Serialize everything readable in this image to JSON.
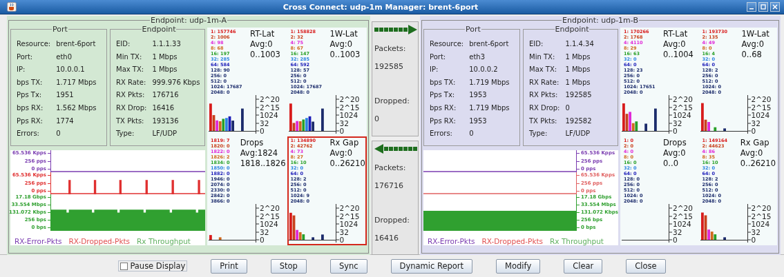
{
  "window": {
    "title": "Cross Connect: udp-1m  Manager: brent-6port"
  },
  "endpoints": [
    {
      "title": "Endpoint: udp-1m-A",
      "color": "#d3e8d3",
      "port": {
        "title": "Port",
        "rows": [
          {
            "label": "Resource:",
            "value": "brent-6port"
          },
          {
            "label": "Port:",
            "value": "eth0"
          },
          {
            "label": "IP:",
            "value": "10.0.0.1"
          },
          {
            "label": "bps TX:",
            "value": "1.717 Mbps"
          },
          {
            "label": "Pps Tx:",
            "value": "1951"
          },
          {
            "label": "bps RX:",
            "value": "1.562 Mbps"
          },
          {
            "label": "Pps RX:",
            "value": "1774"
          },
          {
            "label": "Errors:",
            "value": "0"
          }
        ]
      },
      "endpoint": {
        "title": "Endpoint",
        "rows": [
          {
            "label": "EID:",
            "value": "1.1.1.33"
          },
          {
            "label": "Min TX:",
            "value": "1 Mbps"
          },
          {
            "label": "Max TX:",
            "value": "1 Mbps"
          },
          {
            "label": "RX Rate:",
            "value": "999.976 Kbps"
          },
          {
            "label": "RX Pkts:",
            "value": "176716"
          },
          {
            "label": "RX Drop:",
            "value": "16416"
          },
          {
            "label": "TX Pkts:",
            "value": "193136"
          },
          {
            "label": "Type:",
            "value": "LF/UDP"
          }
        ]
      },
      "graph": {
        "kind": "leftaxis",
        "strips": [
          {
            "kind": "line",
            "color": "#7a3cb0",
            "labels": [
              "65.536 Kpps",
              "256 pps",
              "0 pps"
            ]
          },
          {
            "kind": "spikes",
            "color": "#e03030",
            "labels": [
              "65.536 Kpps",
              "256 pps",
              "0 pps"
            ]
          },
          {
            "kind": "area-dips",
            "color": "#30a030",
            "labels": [
              "17.18 Gbps",
              "33.554 Mbps",
              "131.072 Kbps",
              "256 bps",
              "0 bps"
            ]
          }
        ],
        "legend": [
          {
            "text": "RX-Error-Pkts",
            "color": "#7a3cb0"
          },
          {
            "text": "RX-Dropped-Pkts",
            "color": "#e05050"
          },
          {
            "text": "Rx Throughput",
            "color": "#60b060"
          }
        ]
      },
      "histograms": [
        {
          "title": "RT-Lat",
          "avg": "Avg:0",
          "range": "0..1003",
          "selected": false,
          "buckets": [
            {
              "text": "1: 157746",
              "color": "#d81c1c"
            },
            {
              "text": "2: 1006",
              "color": "#c8401c"
            },
            {
              "text": "4: 98",
              "color": "#e028d8"
            },
            {
              "text": "8: 68",
              "color": "#d0681c"
            },
            {
              "text": "16: 197",
              "color": "#28a028"
            },
            {
              "text": "32: 285",
              "color": "#2c84e0"
            },
            {
              "text": "64: 584",
              "color": "#1c1cb8"
            },
            {
              "text": "128: 90",
              "color": "#1c2c6c"
            },
            {
              "text": "256: 0",
              "color": "#1c2c6c"
            },
            {
              "text": "512: 0",
              "color": "#1c2c6c"
            },
            {
              "text": "1024: 17687",
              "color": "#1c2c6c"
            },
            {
              "text": "2048: 0",
              "color": "#1c2c6c"
            }
          ],
          "axis_labels": [
            "2^20",
            "2^15",
            "1024",
            "32",
            "0"
          ]
        },
        {
          "title": "1W-Lat",
          "avg": "Avg:0",
          "range": "0..1003",
          "selected": false,
          "buckets": [
            {
              "text": "1: 158828",
              "color": "#d81c1c"
            },
            {
              "text": "2: 32",
              "color": "#c8401c"
            },
            {
              "text": "4: 75",
              "color": "#e028d8"
            },
            {
              "text": "8: 67",
              "color": "#d0681c"
            },
            {
              "text": "16: 147",
              "color": "#28a028"
            },
            {
              "text": "32: 285",
              "color": "#2c84e0"
            },
            {
              "text": "64: 592",
              "color": "#1c1cb8"
            },
            {
              "text": "128: 57",
              "color": "#1c2c6c"
            },
            {
              "text": "256: 0",
              "color": "#1c2c6c"
            },
            {
              "text": "512: 0",
              "color": "#1c2c6c"
            },
            {
              "text": "1024: 17687",
              "color": "#1c2c6c"
            },
            {
              "text": "2048: 0",
              "color": "#1c2c6c"
            }
          ],
          "axis_labels": [
            "2^20",
            "2^15",
            "1024",
            "32",
            "0"
          ]
        },
        {
          "title": "Drops",
          "avg": "Avg:1824",
          "range": "1818..1826",
          "selected": false,
          "buckets": [
            {
              "text": "1819: 7",
              "color": "#d81c1c"
            },
            {
              "text": "1820: 0",
              "color": "#c8401c"
            },
            {
              "text": "1822: 0",
              "color": "#e028d8"
            },
            {
              "text": "1826: 2",
              "color": "#d0681c"
            },
            {
              "text": "1834: 0",
              "color": "#28a028"
            },
            {
              "text": "1850: 0",
              "color": "#2c84e0"
            },
            {
              "text": "1882: 0",
              "color": "#1c1cb8"
            },
            {
              "text": "1946: 0",
              "color": "#1c2c6c"
            },
            {
              "text": "2074: 0",
              "color": "#1c2c6c"
            },
            {
              "text": "2330: 0",
              "color": "#1c2c6c"
            },
            {
              "text": "2842: 0",
              "color": "#1c2c6c"
            },
            {
              "text": "3866: 0",
              "color": "#1c2c6c"
            }
          ],
          "axis_labels": [
            "2^20",
            "2^15",
            "1024",
            "32",
            "0"
          ]
        },
        {
          "title": "Rx Gap",
          "avg": "Avg:0",
          "range": "0..26210",
          "selected": true,
          "buckets": [
            {
              "text": "1: 134890",
              "color": "#d81c1c"
            },
            {
              "text": "2: 42762",
              "color": "#c8401c"
            },
            {
              "text": "4: 73",
              "color": "#e028d8"
            },
            {
              "text": "8: 27",
              "color": "#d0681c"
            },
            {
              "text": "16: 10",
              "color": "#28a028"
            },
            {
              "text": "32: 0",
              "color": "#2c84e0"
            },
            {
              "text": "64: 0",
              "color": "#1c1cb8"
            },
            {
              "text": "128: 2",
              "color": "#1c2c6c"
            },
            {
              "text": "256: 0",
              "color": "#1c2c6c"
            },
            {
              "text": "512: 0",
              "color": "#1c2c6c"
            },
            {
              "text": "1024: 9",
              "color": "#1c2c6c"
            },
            {
              "text": "2048: 0",
              "color": "#1c2c6c"
            }
          ],
          "axis_labels": [
            "2^20",
            "2^15",
            "1024",
            "32",
            "0"
          ]
        }
      ]
    },
    {
      "title": "Endpoint: udp-1m-B",
      "color": "#dcdcf0",
      "port": {
        "title": "Port",
        "rows": [
          {
            "label": "Resource:",
            "value": "brent-6port"
          },
          {
            "label": "Port:",
            "value": "eth3"
          },
          {
            "label": "IP:",
            "value": "10.0.0.2"
          },
          {
            "label": "bps TX:",
            "value": "1.719 Mbps"
          },
          {
            "label": "Pps Tx:",
            "value": "1953"
          },
          {
            "label": "bps RX:",
            "value": "1.719 Mbps"
          },
          {
            "label": "Pps RX:",
            "value": "1953"
          },
          {
            "label": "Errors:",
            "value": "0"
          }
        ]
      },
      "endpoint": {
        "title": "Endpoint",
        "rows": [
          {
            "label": "EID:",
            "value": "1.1.4.34"
          },
          {
            "label": "Min TX:",
            "value": "1 Mbps"
          },
          {
            "label": "Max TX:",
            "value": "1 Mbps"
          },
          {
            "label": "RX Rate:",
            "value": "1 Mbps"
          },
          {
            "label": "RX Pkts:",
            "value": "192585"
          },
          {
            "label": "RX Drop:",
            "value": "0"
          },
          {
            "label": "TX Pkts:",
            "value": "192582"
          },
          {
            "label": "Type:",
            "value": "LF/UDP"
          }
        ]
      },
      "graph": {
        "kind": "rightaxis",
        "strips": [
          {
            "kind": "line",
            "color": "#7a3cb0",
            "labels": [
              "65.536 Kpps",
              "256 pps",
              "0 pps"
            ]
          },
          {
            "kind": "line",
            "color": "#e06060",
            "labels": [
              "65.536 Kpps",
              "256 pps",
              "0 pps"
            ]
          },
          {
            "kind": "area",
            "color": "#30a030",
            "labels": [
              "17.18 Gbps",
              "33.554 Mbps",
              "131.072 Kbps",
              "256 bps",
              "0 bps"
            ]
          }
        ],
        "legend": [
          {
            "text": "RX-Error-Pkts",
            "color": "#7a3cb0"
          },
          {
            "text": "RX-Dropped-Pkts",
            "color": "#e05050"
          },
          {
            "text": "Rx Throughput",
            "color": "#60b060"
          }
        ]
      },
      "histograms": [
        {
          "title": "RT-Lat",
          "avg": "Avg:0",
          "range": "0..1004",
          "selected": false,
          "buckets": [
            {
              "text": "1: 170266",
              "color": "#d81c1c"
            },
            {
              "text": "2: 1768",
              "color": "#c8401c"
            },
            {
              "text": "4: 4110",
              "color": "#e028d8"
            },
            {
              "text": "8: 29",
              "color": "#d0681c"
            },
            {
              "text": "16: 63",
              "color": "#28a028"
            },
            {
              "text": "32: 0",
              "color": "#2c84e0"
            },
            {
              "text": "64: 0",
              "color": "#1c1cb8"
            },
            {
              "text": "128: 23",
              "color": "#1c2c6c"
            },
            {
              "text": "256: 0",
              "color": "#1c2c6c"
            },
            {
              "text": "512: 0",
              "color": "#1c2c6c"
            },
            {
              "text": "1024: 17651",
              "color": "#1c2c6c"
            },
            {
              "text": "2048: 0",
              "color": "#1c2c6c"
            }
          ],
          "axis_labels": [
            "2^20",
            "2^15",
            "1024",
            "32",
            "0"
          ]
        },
        {
          "title": "1W-Lat",
          "avg": "Avg:0",
          "range": "0..68",
          "selected": false,
          "buckets": [
            {
              "text": "1: 193730",
              "color": "#d81c1c"
            },
            {
              "text": "2: 135",
              "color": "#c8401c"
            },
            {
              "text": "4: 49",
              "color": "#e028d8"
            },
            {
              "text": "8: 0",
              "color": "#d0681c"
            },
            {
              "text": "16: 4",
              "color": "#28a028"
            },
            {
              "text": "32: 0",
              "color": "#2c84e0"
            },
            {
              "text": "64: 0",
              "color": "#1c1cb8"
            },
            {
              "text": "128: 2",
              "color": "#1c2c6c"
            },
            {
              "text": "256: 0",
              "color": "#1c2c6c"
            },
            {
              "text": "512: 0",
              "color": "#1c2c6c"
            },
            {
              "text": "1024: 0",
              "color": "#1c2c6c"
            },
            {
              "text": "2048: 0",
              "color": "#1c2c6c"
            }
          ],
          "axis_labels": [
            "2^20",
            "2^15",
            "1024",
            "32",
            "0"
          ]
        },
        {
          "title": "Drops",
          "avg": "Avg:0",
          "range": "0..0",
          "selected": false,
          "buckets": [
            {
              "text": "1: 0",
              "color": "#d81c1c"
            },
            {
              "text": "2: 0",
              "color": "#c8401c"
            },
            {
              "text": "4: 0",
              "color": "#e028d8"
            },
            {
              "text": "8: 0",
              "color": "#d0681c"
            },
            {
              "text": "16: 0",
              "color": "#28a028"
            },
            {
              "text": "32: 0",
              "color": "#2c84e0"
            },
            {
              "text": "64: 0",
              "color": "#1c1cb8"
            },
            {
              "text": "128: 0",
              "color": "#1c2c6c"
            },
            {
              "text": "256: 0",
              "color": "#1c2c6c"
            },
            {
              "text": "512: 0",
              "color": "#1c2c6c"
            },
            {
              "text": "1024: 0",
              "color": "#1c2c6c"
            },
            {
              "text": "2048: 0",
              "color": "#1c2c6c"
            }
          ],
          "axis_labels": [
            "2^20",
            "2^15",
            "1024",
            "32",
            "0"
          ]
        },
        {
          "title": "Rx Gap",
          "avg": "Avg:0",
          "range": "0..26210",
          "selected": false,
          "buckets": [
            {
              "text": "1: 149164",
              "color": "#d81c1c"
            },
            {
              "text": "2: 44623",
              "color": "#c8401c"
            },
            {
              "text": "4: 86",
              "color": "#e028d8"
            },
            {
              "text": "8: 35",
              "color": "#d0681c"
            },
            {
              "text": "16: 10",
              "color": "#28a028"
            },
            {
              "text": "32: 0",
              "color": "#2c84e0"
            },
            {
              "text": "64: 0",
              "color": "#1c1cb8"
            },
            {
              "text": "128: 2",
              "color": "#1c2c6c"
            },
            {
              "text": "256: 0",
              "color": "#1c2c6c"
            },
            {
              "text": "512: 0",
              "color": "#1c2c6c"
            },
            {
              "text": "1024: 0",
              "color": "#1c2c6c"
            },
            {
              "text": "2048: 0",
              "color": "#1c2c6c"
            }
          ],
          "axis_labels": [
            "2^20",
            "2^15",
            "1024",
            "32",
            "0"
          ]
        }
      ]
    }
  ],
  "transfers": [
    {
      "kind": "outgoing",
      "packets_label": "Packets:",
      "packets": "192585",
      "dropped_label": "Dropped:",
      "dropped": "0"
    },
    {
      "kind": "incoming",
      "packets_label": "Packets:",
      "packets": "176716",
      "dropped_label": "Dropped:",
      "dropped": "16416"
    }
  ],
  "pause": {
    "label": "Pause Display",
    "checked": false
  },
  "buttons": [
    "Print",
    "Stop",
    "Sync",
    "Dynamic Report",
    "Modify",
    "Clear",
    "Close"
  ]
}
